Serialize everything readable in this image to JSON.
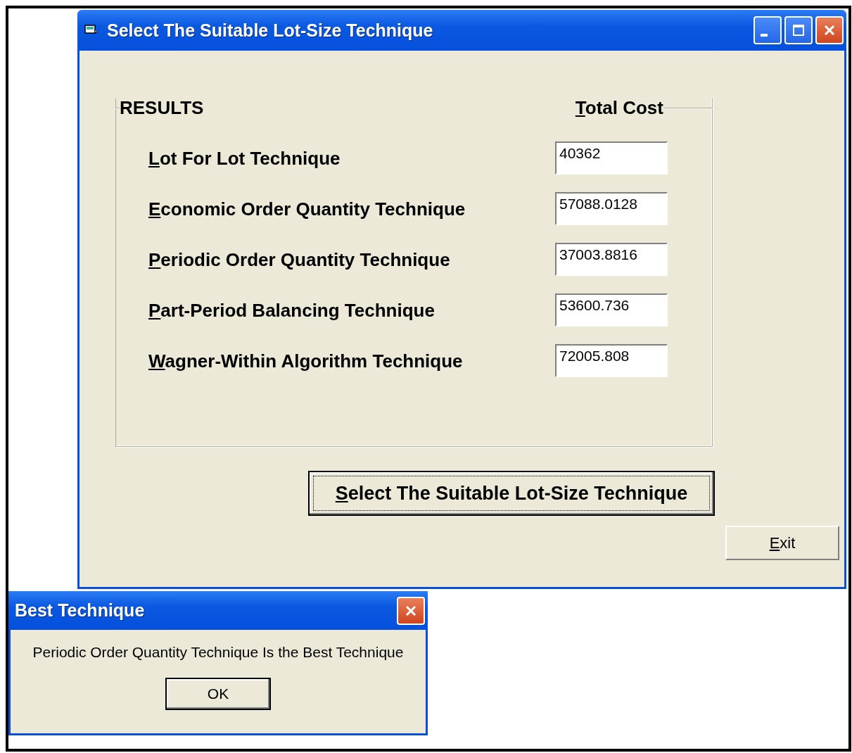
{
  "window": {
    "title": "Select The Suitable Lot-Size Technique"
  },
  "results": {
    "title": "RESULTS",
    "cost_heading": {
      "key": "T",
      "rest": "otal Cost"
    },
    "rows": [
      {
        "label": {
          "key": "L",
          "rest": "ot For Lot Technique"
        },
        "value": "40362"
      },
      {
        "label": {
          "key": "E",
          "rest": "conomic Order Quantity Technique"
        },
        "value": "57088.0128"
      },
      {
        "label": {
          "key": "P",
          "rest": "eriodic Order Quantity Technique"
        },
        "value": "37003.8816"
      },
      {
        "label": {
          "key": "P",
          "rest": "art-Period Balancing Technique"
        },
        "value": "53600.736"
      },
      {
        "label": {
          "key": "W",
          "rest": "agner-Within Algorithm Technique"
        },
        "value": "72005.808"
      }
    ]
  },
  "select_button": {
    "key": "S",
    "rest": "elect The Suitable Lot-Size Technique"
  },
  "exit_button": {
    "key": "E",
    "rest": "xit"
  },
  "dialog": {
    "title": "Best Technique",
    "message": "Periodic Order Quantity Technique Is the Best Technique",
    "button": "OK"
  }
}
